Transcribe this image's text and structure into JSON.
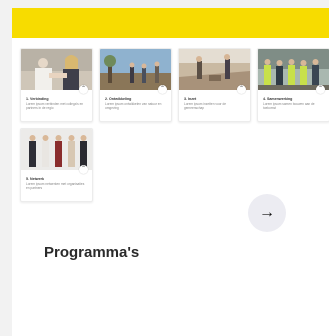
{
  "cards": [
    {
      "title": "1. Verbinding",
      "desc": "Lorem ipsum verbinden met collega's en partners in de regio",
      "badge_icon": "chevron-up-icon"
    },
    {
      "title": "2. Ontwikkeling",
      "desc": "Lorem ipsum ontwikkelen van natuur en omgeving",
      "badge_icon": "chevron-up-icon"
    },
    {
      "title": "3. Inzet",
      "desc": "Lorem ipsum inzetten voor de gemeenschap",
      "badge_icon": "chevron-up-icon"
    },
    {
      "title": "4. Samenwerking",
      "desc": "Lorem ipsum samen bouwen aan de toekomst",
      "badge_icon": "chevron-up-icon"
    },
    {
      "title": "5. Netwerk",
      "desc": "Lorem ipsum netwerken met organisaties en partners",
      "badge_icon": "chevron-up-icon"
    }
  ],
  "next_button": {
    "icon": "arrow-right-icon",
    "glyph": "→"
  },
  "section_title": "Programma's",
  "colors": {
    "accent_bar": "#f7dc00",
    "button_bg": "#ececf2"
  }
}
